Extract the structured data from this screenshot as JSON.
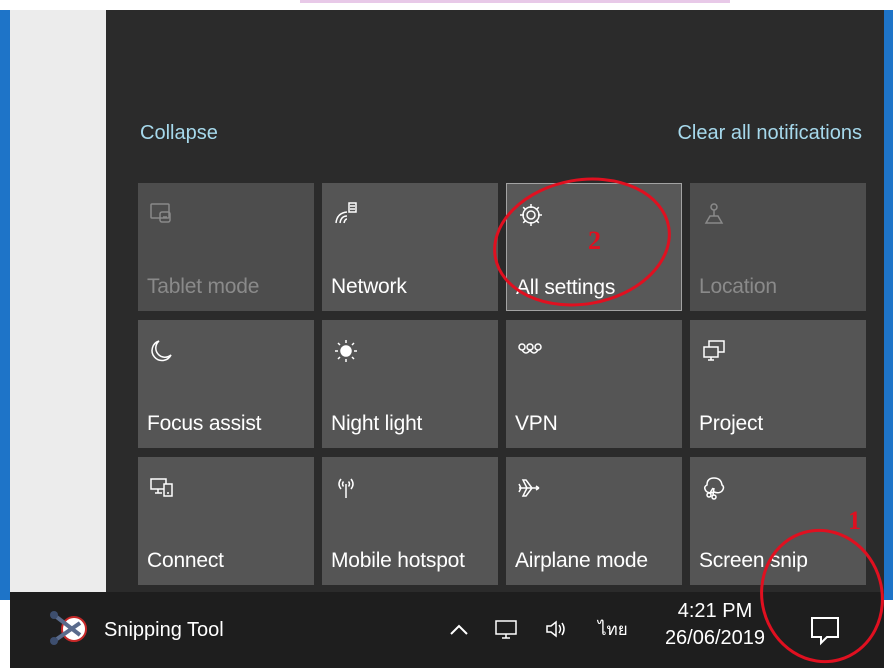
{
  "action_center": {
    "collapse_label": "Collapse",
    "clear_label": "Clear all notifications",
    "background": "#2b2b2b",
    "link_color": "#a6d9ec",
    "tiles": [
      {
        "label": "Tablet mode",
        "icon": "tablet-mode-icon",
        "state": "disabled"
      },
      {
        "label": "Network",
        "icon": "network-icon",
        "state": "normal"
      },
      {
        "label": "All settings",
        "icon": "gear-icon",
        "state": "highlighted"
      },
      {
        "label": "Location",
        "icon": "location-icon",
        "state": "disabled"
      },
      {
        "label": "Focus assist",
        "icon": "moon-icon",
        "state": "normal"
      },
      {
        "label": "Night light",
        "icon": "sun-icon",
        "state": "normal"
      },
      {
        "label": "VPN",
        "icon": "vpn-icon",
        "state": "normal"
      },
      {
        "label": "Project",
        "icon": "project-icon",
        "state": "normal"
      },
      {
        "label": "Connect",
        "icon": "connect-icon",
        "state": "normal"
      },
      {
        "label": "Mobile hotspot",
        "icon": "hotspot-icon",
        "state": "normal"
      },
      {
        "label": "Airplane mode",
        "icon": "airplane-icon",
        "state": "normal"
      },
      {
        "label": "Screen snip",
        "icon": "screen-snip-icon",
        "state": "normal"
      }
    ]
  },
  "taskbar": {
    "app_label": "Snipping Tool",
    "app_icon": "snipping-tool-icon",
    "tray_icons": [
      "chevron-up-icon",
      "network-tray-icon",
      "volume-icon"
    ],
    "ime_label": "ไทย",
    "time": "4:21 PM",
    "date": "26/06/2019",
    "notification_icon": "notification-icon"
  },
  "annotations": {
    "marker_1": "1",
    "marker_2": "2",
    "color": "#e01020"
  }
}
